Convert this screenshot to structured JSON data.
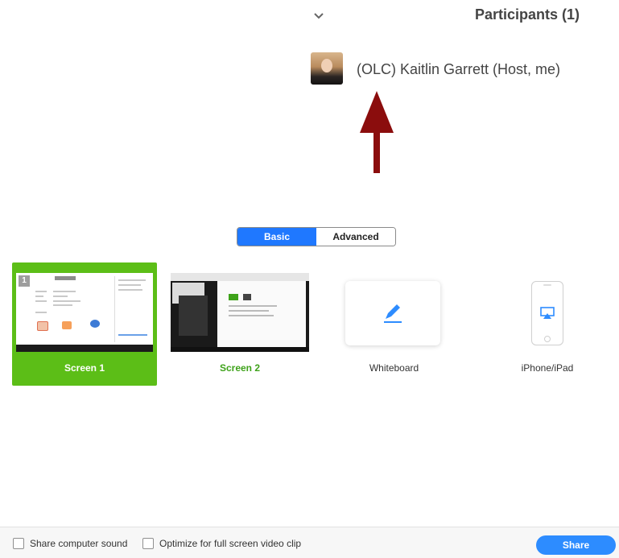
{
  "participants": {
    "title": "Participants (1)",
    "collapse_icon": "chevron-down-icon",
    "items": [
      {
        "name": "(OLC) Kaitlin Garrett (Host, me)"
      }
    ]
  },
  "annotation": {
    "arrow_color": "#8b0d0d",
    "icon": "up-arrow-icon"
  },
  "share_dialog": {
    "tabs": [
      {
        "label": "Basic",
        "active": true
      },
      {
        "label": "Advanced",
        "active": false
      }
    ],
    "sources": [
      {
        "label": "Screen 1",
        "badge": "1",
        "selected": true
      },
      {
        "label": "Screen 2",
        "selected": false
      },
      {
        "label": "Whiteboard",
        "icon": "pencil-icon"
      },
      {
        "label": "iPhone/iPad",
        "icon": "airplay-icon"
      }
    ],
    "options": {
      "share_sound": "Share computer sound",
      "optimize_video": "Optimize for full screen video clip"
    },
    "share_button": "Share"
  },
  "colors": {
    "selected_tile": "#5cbe17",
    "accent_blue": "#1f78ff",
    "share_button": "#2d8cff"
  }
}
